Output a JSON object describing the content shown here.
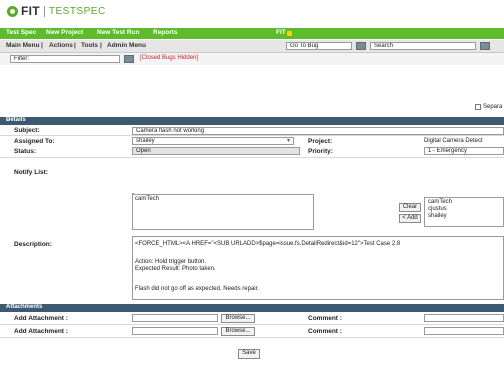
{
  "app": {
    "logo_left": "FIT",
    "logo_right": "TESTSPEC"
  },
  "nav": {
    "items": [
      "Test Spec",
      "New Project",
      "New Test Run",
      "Reports"
    ],
    "extra": "FIT"
  },
  "toolbar": {
    "left": [
      "Main Menu",
      "|",
      "Actions",
      "|",
      "Tools",
      "|",
      "Admin Menu"
    ],
    "goto_bug": "Go To Bug",
    "search": "Search"
  },
  "filter": {
    "label": "Filter:",
    "closed_bugs": "[Closed Bugs Hidden]"
  },
  "separate_label": "Separa",
  "details": {
    "section_title": "Details",
    "subject_label": "Subject:",
    "subject_value": "Camera flash not working",
    "assigned_label": "Assigned To:",
    "assigned_value": "shailey",
    "project_label": "Project:",
    "project_value": "Digital Camera Detect",
    "status_label": "Status:",
    "status_value": "Open",
    "priority_label": "Priority:",
    "priority_value": "1 - Emergency",
    "notify_label": "Notify List:",
    "notify_value": "camTech",
    "clear_button": "Clear",
    "add_button": "< Add",
    "notify_options": [
      "camTech",
      "cjustus",
      "shailey"
    ],
    "description_label": "Description:",
    "description_lines": [
      "<FORCE_HTML><A HREF=\"<SUB URLADD>$page=issue.fs.DetailRedirect&id=12\">Test Case 2.8",
      "Action: Hold trigger button.",
      "Expected Result: Photo taken.",
      "Flash did not go off as expected.  Needs repair."
    ]
  },
  "attachments": {
    "section_title": "Attachments",
    "rows": [
      {
        "label": "Add Attachment :",
        "browse": "Browse...",
        "comment": "Comment :"
      },
      {
        "label": "Add Attachment :",
        "browse": "Browse...",
        "comment": "Comment :"
      }
    ]
  },
  "save_button": "Save",
  "colors": {
    "nav_green": "#5dbb2c",
    "section_blue": "#3e5a73",
    "closed_red": "#cc2222",
    "logo_green": "#5aa82c"
  }
}
